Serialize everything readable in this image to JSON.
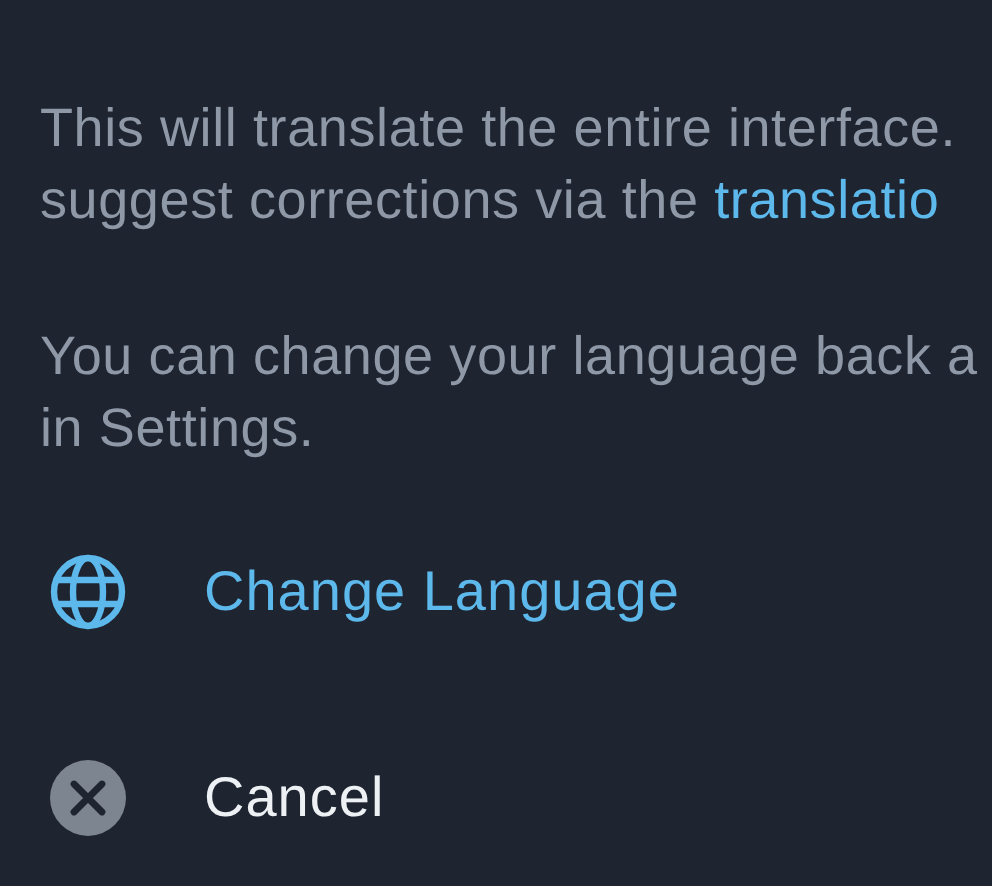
{
  "paragraphs": [
    {
      "lines": [
        [
          {
            "text": "This will translate the entire interface."
          }
        ],
        [
          {
            "text": "suggest corrections via the "
          },
          {
            "text": "translatio",
            "link": true
          }
        ]
      ]
    },
    {
      "lines": [
        [
          {
            "text": "You can change your language back a"
          }
        ],
        [
          {
            "text": "in Settings."
          }
        ]
      ]
    }
  ],
  "actions": [
    {
      "kind": "globe",
      "label": "Change Language"
    },
    {
      "kind": "cancel",
      "label": "Cancel"
    }
  ]
}
